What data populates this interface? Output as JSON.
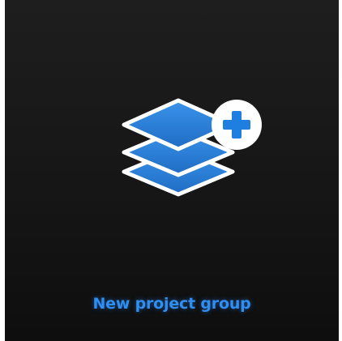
{
  "tile": {
    "label": "New project group",
    "icon": "layers-plus-icon",
    "badge_icon": "plus-icon"
  },
  "colors": {
    "label": "#2f8ef0",
    "layer_blue": "#2b7fd9",
    "layer_outline": "#ffffff",
    "badge_background": "#ffffff",
    "badge_plus": "#1e7fe0",
    "tile_background": "#161616"
  }
}
